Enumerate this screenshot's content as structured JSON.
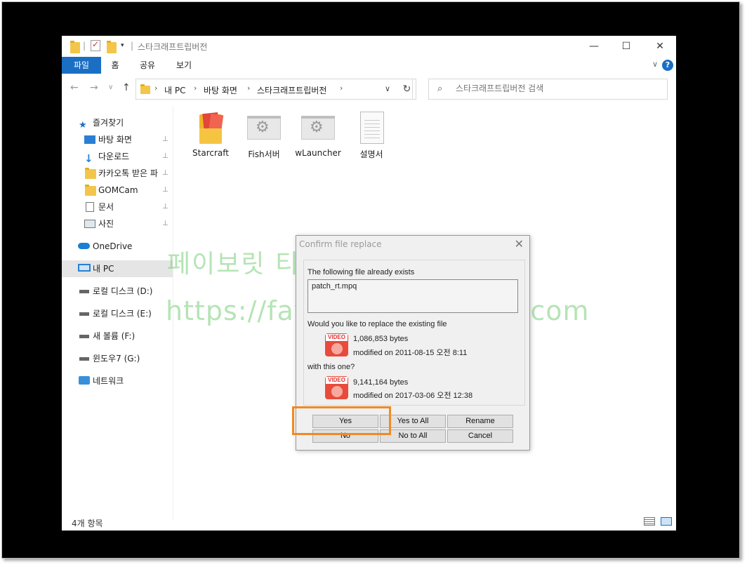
{
  "window": {
    "title": "스타크래프트립버전",
    "controls": {
      "minimize": "—",
      "maximize": "☐",
      "close": "✕"
    }
  },
  "ribbon": {
    "tabs": [
      "파일",
      "홈",
      "공유",
      "보기"
    ],
    "expand": "∨",
    "help": "?"
  },
  "address": {
    "back": "←",
    "forward": "→",
    "recent": "∨",
    "up": "↑",
    "crumbs": [
      "내 PC",
      "바탕 화면",
      "스타크래프트립버전"
    ],
    "refresh": "↻",
    "dropdown": "∨"
  },
  "search": {
    "placeholder": "스타크래프트립버전 검색"
  },
  "sidebar": {
    "items": [
      {
        "label": "즐겨찾기",
        "pinned": false
      },
      {
        "label": "바탕 화면",
        "pinned": true
      },
      {
        "label": "다운로드",
        "pinned": true
      },
      {
        "label": "카카오톡 받은 파",
        "pinned": true
      },
      {
        "label": "GOMCam",
        "pinned": true
      },
      {
        "label": "문서",
        "pinned": true
      },
      {
        "label": "사진",
        "pinned": true
      },
      {
        "label": "OneDrive",
        "pinned": false
      },
      {
        "label": "내 PC",
        "pinned": false
      },
      {
        "label": "로컬 디스크 (D:)",
        "pinned": false
      },
      {
        "label": "로컬 디스크 (E:)",
        "pinned": false
      },
      {
        "label": "새 볼륨 (F:)",
        "pinned": false
      },
      {
        "label": "윈도우7 (G:)",
        "pinned": false
      },
      {
        "label": "네트워크",
        "pinned": false
      }
    ],
    "pin_glyph": "📌"
  },
  "files": [
    {
      "name": "Starcraft",
      "icon": "video-folder-icon"
    },
    {
      "name": "Fish서버",
      "icon": "settings-file-icon"
    },
    {
      "name": "wLauncher",
      "icon": "settings-file-icon"
    },
    {
      "name": "설명서",
      "icon": "text-file-icon"
    }
  ],
  "status": {
    "count": "4개 항목"
  },
  "watermark": {
    "line1": "페이보릿 티스토리",
    "line2": "https://favoritepps.tistory.com"
  },
  "dialog": {
    "title": "Confirm file replace",
    "close": "✕",
    "exists_msg": "The following file already exists",
    "filename": "patch_rt.mpq",
    "replace_msg": "Would you like to replace the existing file",
    "existing": {
      "size": "1,086,853 bytes",
      "modified": "modified on 2011-08-15 오전 8:11"
    },
    "with_msg": "with this one?",
    "new": {
      "size": "9,141,164 bytes",
      "modified": "modified on 2017-03-06 오전 12:38"
    },
    "video_label": "VIDEO",
    "buttons": {
      "yes": "Yes",
      "yes_all": "Yes to All",
      "rename": "Rename",
      "no": "No",
      "no_all": "No to All",
      "cancel": "Cancel"
    }
  },
  "colors": {
    "accent": "#1a6fc4",
    "highlight": "#f08a24",
    "video_icon": "#e84b3c"
  }
}
